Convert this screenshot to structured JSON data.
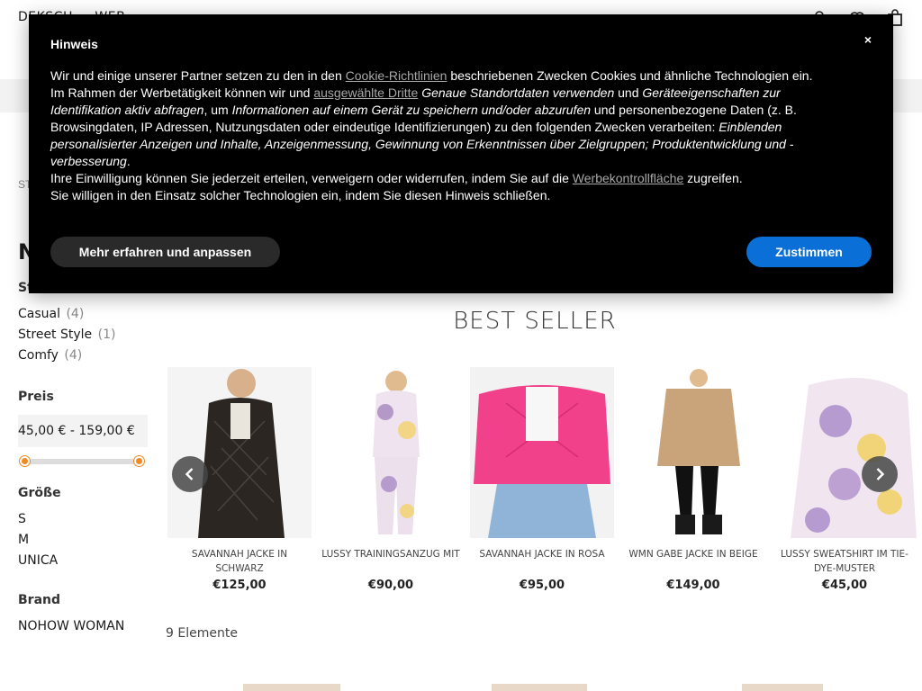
{
  "header": {
    "logo": "DEKSCH — WEB",
    "icons": [
      "account-icon",
      "wishlist-icon",
      "cart-icon"
    ]
  },
  "breadcrumb": "ST",
  "page_title": "N",
  "filters": {
    "style": {
      "title": "Sti",
      "items": [
        {
          "label": "Casual",
          "count": "(4)"
        },
        {
          "label": "Street Style",
          "count": "(1)"
        },
        {
          "label": "Comfy",
          "count": "(4)"
        }
      ]
    },
    "price": {
      "title": "Preis",
      "range_text": "45,00 € - 159,00 €",
      "min_fraction": 0,
      "max_fraction": 1
    },
    "size": {
      "title": "Größe",
      "items": [
        "S",
        "M",
        "UNICA"
      ]
    },
    "brand": {
      "title": "Brand",
      "items": [
        "NOHOW WOMAN"
      ]
    }
  },
  "best_seller": {
    "title": "BEST SELLER",
    "products": [
      {
        "name": "SAVANNAH JACKE IN SCHWARZ",
        "price": "€125,00"
      },
      {
        "name": "LUSSY TRAININGSANZUG MIT",
        "price": "€90,00"
      },
      {
        "name": "SAVANNAH JACKE IN ROSA",
        "price": "€95,00"
      },
      {
        "name": "WMN GABE JACKE IN BEIGE",
        "price": "€149,00"
      },
      {
        "name": "LUSSY SWEATSHIRT IM TIE-DYE-MUSTER",
        "price": "€45,00"
      }
    ]
  },
  "item_count": "9 Elemente",
  "modal": {
    "title": "Hinweis",
    "close": "×",
    "p1_a": "Wir und einige unserer Partner setzen zu den in den ",
    "p1_link": "Cookie-Richtlinien",
    "p1_b": " beschriebenen Zwecken Cookies und ähnliche Technologien ein.",
    "p2_a": "Im Rahmen der Werbetätigkeit können wir und ",
    "p2_link": "ausgewählte Dritte",
    "p2_i1": "Genaue Standortdaten verwenden",
    "p2_b": " und ",
    "p2_i2": "Geräteeigenschaften zur Identifikation aktiv abfragen",
    "p2_c": ", um ",
    "p2_i3": "Informationen auf einem Gerät zu speichern und/oder abzurufen",
    "p2_d": " und personenbezogene Daten (z. B. Browsingdaten, IP Adressen, Nutzungsdaten oder eindeutige Identifizierungen) zu den folgenden Zwecken verarbeiten: ",
    "p2_i4": "Einblenden personalisierter Anzeigen und Inhalte, Anzeigenmessung, Gewinnung von Erkenntnissen über Zielgruppen; Produktentwicklung und -verbesserung",
    "p2_e": ".",
    "p3_a": "Ihre Einwilligung können Sie jederzeit erteilen, verweigern oder widerrufen, indem Sie auf die ",
    "p3_link": "Werbekontrollfläche",
    "p3_b": " zugreifen.",
    "p4": "Sie willigen in den Einsatz solcher Technologien ein, indem Sie diesen Hinweis schließen.",
    "btn_more": "Mehr erfahren und anpassen",
    "btn_accept": "Zustimmen"
  },
  "colors": {
    "accent_orange": "#f08a24",
    "accept_blue": "#0a6fd6",
    "modal_bg": "#000000"
  }
}
